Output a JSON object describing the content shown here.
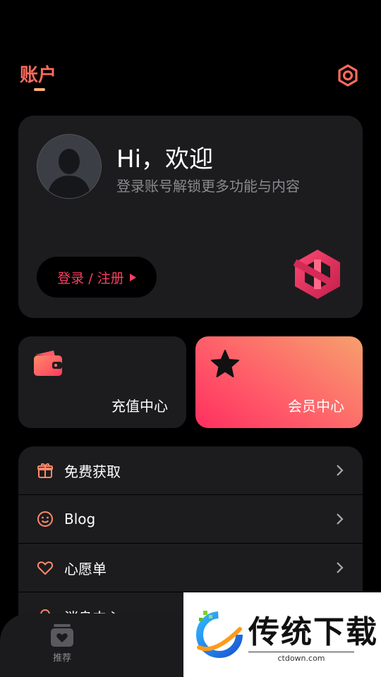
{
  "header": {
    "title": "账户",
    "settings_icon": "settings-icon",
    "accent_color": "#ff6a5c"
  },
  "profile": {
    "greeting": "Hi，欢迎",
    "subtitle": "登录账号解锁更多功能与内容",
    "login_label": "登录 / 注册",
    "avatar_icon": "default-avatar-icon",
    "logo_icon": "brand-logo-icon"
  },
  "quick": {
    "recharge_label": "充值中心",
    "recharge_icon": "wallet-icon",
    "vip_label": "会员中心",
    "vip_icon": "star-icon"
  },
  "menu": {
    "items": [
      {
        "label": "免费获取",
        "icon": "gift-icon"
      },
      {
        "label": "Blog",
        "icon": "smile-icon"
      },
      {
        "label": "心愿单",
        "icon": "heart-icon"
      },
      {
        "label": "消息中心",
        "icon": "bell-icon"
      }
    ]
  },
  "bottom_nav": {
    "items": [
      {
        "label": "推荐",
        "icon": "recommend-icon"
      }
    ]
  },
  "watermark": {
    "name": "传统下载",
    "url": "ctdown.com"
  }
}
